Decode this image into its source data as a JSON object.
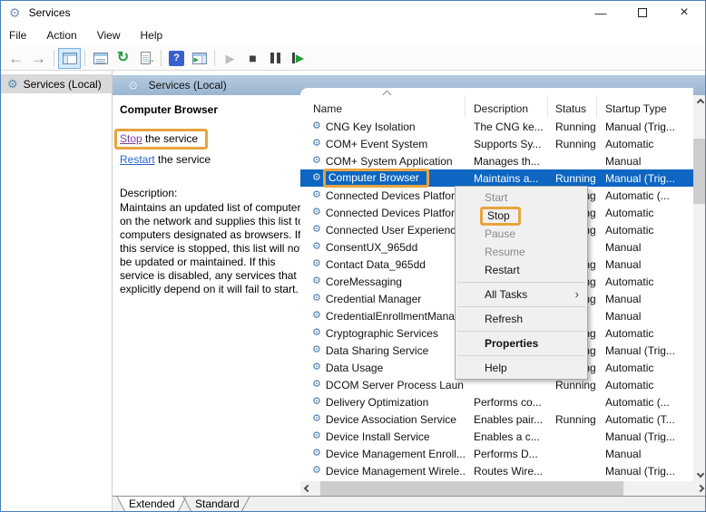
{
  "window": {
    "title": "Services",
    "app_icon": "⚙",
    "minimize_glyph": "—",
    "close_glyph": "×"
  },
  "menu_bar": {
    "items": [
      "File",
      "Action",
      "View",
      "Help"
    ]
  },
  "toolbar": {
    "back_glyph": "←",
    "forward_glyph": "→",
    "refresh_glyph": "↻",
    "export_arrow_glyph": "→",
    "help_glyph": "?",
    "action_pane_play_glyph": "▶",
    "start_glyph": "▶",
    "stop_glyph": "■",
    "restart_play_glyph": "▶"
  },
  "tree": {
    "root_label": "Services (Local)",
    "root_icon": "⚙"
  },
  "banner": {
    "title": "Services (Local)",
    "icon": "⚙"
  },
  "info_panel": {
    "service_name": "Computer Browser",
    "stop_link_text": "Stop",
    "stop_rest": " the service",
    "restart_link_text": "Restart",
    "restart_rest": " the service",
    "description_label": "Description:",
    "description_text": "Maintains an updated list of computers on the network and supplies this list to computers designated as browsers. If this service is stopped, this list will not be updated or maintained. If this service is disabled, any services that explicitly depend on it will fail to start."
  },
  "list": {
    "columns": [
      "Name",
      "Description",
      "Status",
      "Startup Type"
    ],
    "service_icon": "⚙",
    "rows": [
      {
        "name": "CNG Key Isolation",
        "description": "The CNG ke...",
        "status": "Running",
        "startup": "Manual (Trig..."
      },
      {
        "name": "COM+ Event System",
        "description": "Supports Sy...",
        "status": "Running",
        "startup": "Automatic"
      },
      {
        "name": "COM+ System Application",
        "description": "Manages th...",
        "status": "",
        "startup": "Manual"
      },
      {
        "name": "Computer Browser",
        "description": "Maintains a...",
        "status": "Running",
        "startup": "Manual (Trig...",
        "selected": true,
        "highlighted": true
      },
      {
        "name": "Connected Devices Platfor",
        "description": "",
        "status": "Running",
        "startup": "Automatic (..."
      },
      {
        "name": "Connected Devices Platfor",
        "description": "",
        "status": "Running",
        "startup": "Automatic"
      },
      {
        "name": "Connected User Experience",
        "description": "",
        "status": "Running",
        "startup": "Automatic"
      },
      {
        "name": "ConsentUX_965dd",
        "description": "",
        "status": "",
        "startup": "Manual"
      },
      {
        "name": "Contact Data_965dd",
        "description": "",
        "status": "Running",
        "startup": "Manual"
      },
      {
        "name": "CoreMessaging",
        "description": "",
        "status": "Running",
        "startup": "Automatic"
      },
      {
        "name": "Credential Manager",
        "description": "",
        "status": "Running",
        "startup": "Manual"
      },
      {
        "name": "CredentialEnrollmentMana",
        "description": "",
        "status": "",
        "startup": "Manual"
      },
      {
        "name": "Cryptographic Services",
        "description": "",
        "status": "Running",
        "startup": "Automatic"
      },
      {
        "name": "Data Sharing Service",
        "description": "",
        "status": "Running",
        "startup": "Manual (Trig..."
      },
      {
        "name": "Data Usage",
        "description": "",
        "status": "Running",
        "startup": "Automatic"
      },
      {
        "name": "DCOM Server Process Laun",
        "description": "",
        "status": "Running",
        "startup": "Automatic"
      },
      {
        "name": "Delivery Optimization",
        "description": "Performs co...",
        "status": "",
        "startup": "Automatic (..."
      },
      {
        "name": "Device Association Service",
        "description": "Enables pair...",
        "status": "Running",
        "startup": "Automatic (T..."
      },
      {
        "name": "Device Install Service",
        "description": "Enables a c...",
        "status": "",
        "startup": "Manual (Trig..."
      },
      {
        "name": "Device Management Enroll...",
        "description": "Performs D...",
        "status": "",
        "startup": "Manual"
      },
      {
        "name": "Device Management Wirele...",
        "description": "Routes Wire...",
        "status": "",
        "startup": "Manual (Trig..."
      }
    ]
  },
  "context_menu": {
    "submenu_arrow": "›",
    "items": [
      {
        "label": "Start",
        "disabled": true
      },
      {
        "label": "Stop",
        "highlighted": true
      },
      {
        "label": "Pause",
        "disabled": true
      },
      {
        "label": "Resume",
        "disabled": true
      },
      {
        "label": "Restart"
      },
      {
        "separator": true
      },
      {
        "label": "All Tasks",
        "submenu": true
      },
      {
        "separator": true
      },
      {
        "label": "Refresh"
      },
      {
        "separator": true
      },
      {
        "label": "Properties",
        "bold": true
      },
      {
        "separator": true
      },
      {
        "label": "Help"
      }
    ]
  },
  "tabs": {
    "extended": "Extended",
    "standard": "Standard"
  },
  "colors": {
    "selection_blue": "#0c66c2",
    "annotation_orange": "#E8A33D",
    "banner_blue": "#a9c0d8",
    "visited_link_purple": "#7b3f9d",
    "link_blue": "#2864cc"
  }
}
